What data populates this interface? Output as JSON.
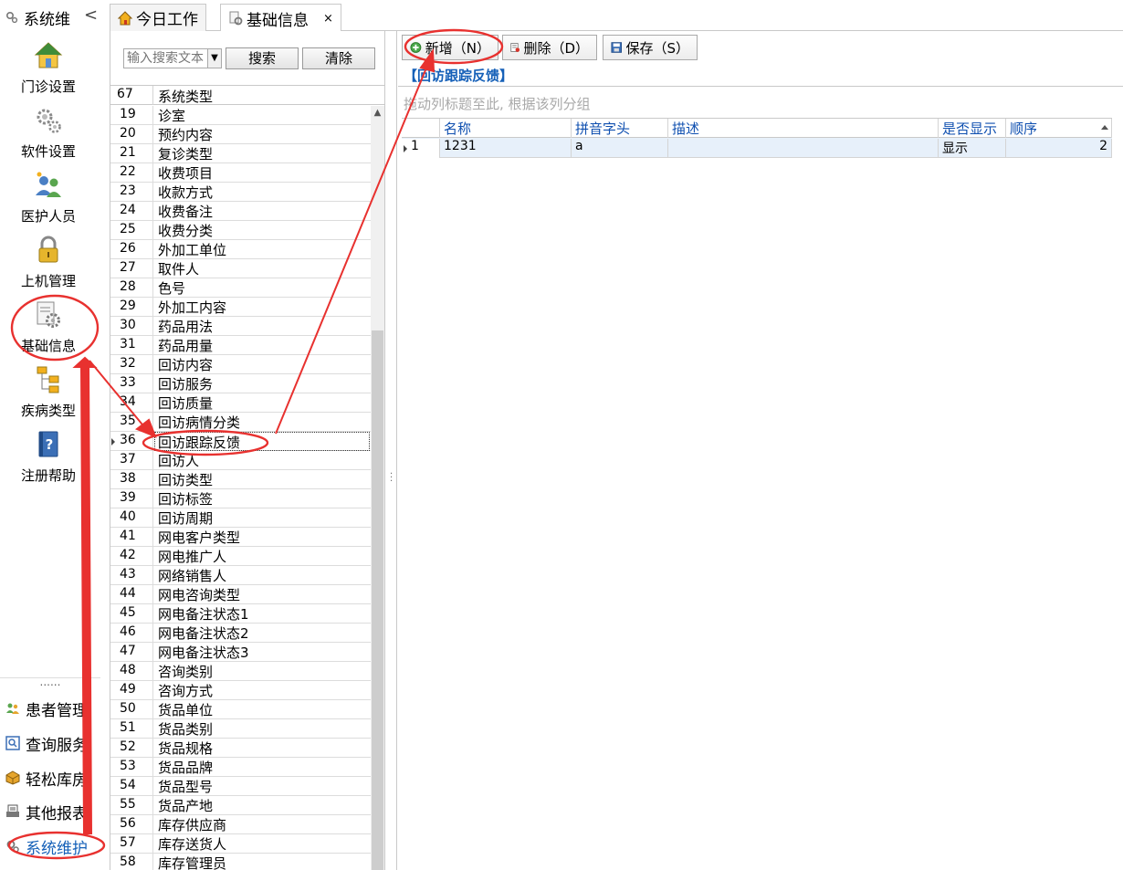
{
  "nav": {
    "header_title": "系统维",
    "collapse_glyph": "<",
    "items": [
      {
        "label": "门诊设置",
        "icon": "house-icon"
      },
      {
        "label": "软件设置",
        "icon": "gears-icon"
      },
      {
        "label": "医护人员",
        "icon": "users-icon"
      },
      {
        "label": "上机管理",
        "icon": "lock-icon"
      },
      {
        "label": "基础信息",
        "icon": "gear-document-icon"
      },
      {
        "label": "疾病类型",
        "icon": "tree-icon"
      },
      {
        "label": "注册帮助",
        "icon": "help-book-icon"
      }
    ],
    "dots": "......",
    "modules": [
      {
        "label": "患者管理",
        "icon": "patients-icon"
      },
      {
        "label": "查询服务",
        "icon": "query-icon"
      },
      {
        "label": "轻松库房",
        "icon": "warehouse-icon"
      },
      {
        "label": "其他报表",
        "icon": "report-icon"
      },
      {
        "label": "系统维护",
        "icon": "system-gear-icon"
      }
    ]
  },
  "tabs": [
    {
      "label": "今日工作",
      "icon": "home-icon"
    },
    {
      "label": "基础信息",
      "icon": "gear-document-icon",
      "close": "×"
    }
  ],
  "search": {
    "placeholder": "输入搜索文本",
    "search_label": "搜索",
    "clear_label": "清除"
  },
  "list": {
    "header_num": "67",
    "header_name": "系统类型",
    "rows": [
      {
        "num": "19",
        "name": "诊室"
      },
      {
        "num": "20",
        "name": "预约内容"
      },
      {
        "num": "21",
        "name": "复诊类型"
      },
      {
        "num": "22",
        "name": "收费项目"
      },
      {
        "num": "23",
        "name": "收款方式"
      },
      {
        "num": "24",
        "name": "收费备注"
      },
      {
        "num": "25",
        "name": "收费分类"
      },
      {
        "num": "26",
        "name": "外加工单位"
      },
      {
        "num": "27",
        "name": "取件人"
      },
      {
        "num": "28",
        "name": "色号"
      },
      {
        "num": "29",
        "name": "外加工内容"
      },
      {
        "num": "30",
        "name": "药品用法"
      },
      {
        "num": "31",
        "name": "药品用量"
      },
      {
        "num": "32",
        "name": "回访内容"
      },
      {
        "num": "33",
        "name": "回访服务"
      },
      {
        "num": "34",
        "name": "回访质量"
      },
      {
        "num": "35",
        "name": "回访病情分类"
      },
      {
        "num": "36",
        "name": "回访跟踪反馈",
        "selected": true
      },
      {
        "num": "37",
        "name": "回访人"
      },
      {
        "num": "38",
        "name": "回访类型"
      },
      {
        "num": "39",
        "name": "回访标签"
      },
      {
        "num": "40",
        "name": "回访周期"
      },
      {
        "num": "41",
        "name": "网电客户类型"
      },
      {
        "num": "42",
        "name": "网电推广人"
      },
      {
        "num": "43",
        "name": "网络销售人"
      },
      {
        "num": "44",
        "name": "网电咨询类型"
      },
      {
        "num": "45",
        "name": "网电备注状态1"
      },
      {
        "num": "46",
        "name": "网电备注状态2"
      },
      {
        "num": "47",
        "name": "网电备注状态3"
      },
      {
        "num": "48",
        "name": "咨询类别"
      },
      {
        "num": "49",
        "name": "咨询方式"
      },
      {
        "num": "50",
        "name": "货品单位"
      },
      {
        "num": "51",
        "name": "货品类别"
      },
      {
        "num": "52",
        "name": "货品规格"
      },
      {
        "num": "53",
        "name": "货品品牌"
      },
      {
        "num": "54",
        "name": "货品型号"
      },
      {
        "num": "55",
        "name": "货品产地"
      },
      {
        "num": "56",
        "name": "库存供应商"
      },
      {
        "num": "57",
        "name": "库存送货人"
      },
      {
        "num": "58",
        "name": "库存管理员"
      }
    ]
  },
  "toolbar": {
    "add_label": "新增（N）",
    "delete_label": "删除（D）",
    "save_label": "保存（S）"
  },
  "detail": {
    "section_title": "【回访跟踪反馈】",
    "group_hint": "拖动列标题至此, 根据该列分组",
    "columns": [
      "名称",
      "拼音字头",
      "描述",
      "是否显示",
      "顺序"
    ],
    "rows": [
      {
        "index": "1",
        "name": "1231",
        "pinyin": "a",
        "desc": "",
        "show": "显示",
        "order": "2"
      }
    ]
  },
  "colors": {
    "accent_blue": "#1560b8",
    "annotation_red": "#e8312f",
    "selected_row": "#e7f0fa"
  }
}
